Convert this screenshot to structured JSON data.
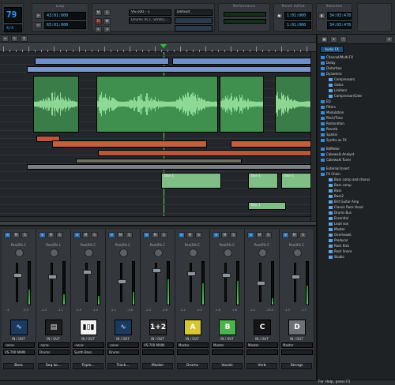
{
  "control_bar": {
    "tempo_display": "79",
    "meter_display": "4/4",
    "loop_module": {
      "label": "Loop",
      "start": "43:01:000",
      "end": "65:01:000"
    },
    "toolbar_buttons": [
      "M",
      "S",
      "R",
      "W"
    ],
    "track_select": "VS-100 - 1",
    "track_name": "Drums ACT, Strato...",
    "preset_select": "Default",
    "performance_label": "Performance",
    "punch_module": {
      "label": "Punch In/Out",
      "start": "1:01:000",
      "end": "1:01:000"
    },
    "selection_module": {
      "label": "Selection",
      "start": "34:03:478",
      "end": "34:03:478"
    }
  },
  "track_view": {
    "clip_labels": [
      "Take 1",
      "Take 1",
      "Take 1",
      "Take 1"
    ]
  },
  "console": {
    "strips": [
      {
        "pan_label": "Pan(0% C",
        "db_left": "-4",
        "db_right": "-3.3",
        "tile": "wave",
        "io": "IN / OUT",
        "input": "-none-",
        "output": "VS-700 MAIN",
        "name": "Bass"
      },
      {
        "pan_label": "Pan(0% L",
        "db_left": "-4.3",
        "db_right": "-1.1",
        "tile": "seq",
        "io": "IN / OUT",
        "input": "-none-",
        "output": "Drums",
        "name": "Seq ko..."
      },
      {
        "pan_label": "Pan(0% C",
        "db_left": "-1.5",
        "db_right": "-1.4",
        "tile": "keys",
        "io": "IN / OUT",
        "input": "-none-",
        "output": "Synth Bass",
        "name": "Triple..."
      },
      {
        "pan_label": "Pan(0% C",
        "db_left": "-2.2",
        "db_right": "-3.8",
        "tile": "wave",
        "io": "IN / OUT",
        "input": "-none-",
        "output": "Drums",
        "name": "Track..."
      },
      {
        "pan_label": "Pan(0% C",
        "db_left": "-2.3",
        "db_right": "-4.8",
        "tile": "1+2",
        "io": "IN / OUT",
        "input": "VS-700 MAIN",
        "output": "",
        "name": "Master"
      },
      {
        "pan_label": "Pan(0% C",
        "db_left": "-2.2",
        "db_right": "-0.2",
        "tile": "A",
        "io": "IN / OUT",
        "input": "Master",
        "output": "",
        "name": "Drums"
      },
      {
        "pan_label": "Pan(0% C",
        "db_left": "-1.8",
        "db_right": "-1.8",
        "tile": "B",
        "io": "IN / OUT",
        "input": "Master",
        "output": "",
        "name": "Vocals"
      },
      {
        "pan_label": "Pan(0% C",
        "db_left": "-1.2",
        "db_right": "-20.2",
        "tile": "C",
        "io": "IN / OUT",
        "input": "Master",
        "output": "",
        "name": "Verb"
      },
      {
        "pan_label": "Pan(0% C",
        "db_left": "-1.3",
        "db_right": "-1.7",
        "tile": "D",
        "io": "IN / OUT",
        "input": "Master",
        "output": "",
        "name": "Strings"
      }
    ]
  },
  "browser": {
    "header": "Audio FX",
    "tree": [
      {
        "label": "Channel/Multi-FX",
        "level": 0
      },
      {
        "label": "Delay",
        "level": 0
      },
      {
        "label": "Distortion",
        "level": 0
      },
      {
        "label": "Dynamics",
        "level": 0
      },
      {
        "label": "Compressors",
        "level": 1
      },
      {
        "label": "Gates",
        "level": 1
      },
      {
        "label": "Limiters",
        "level": 1
      },
      {
        "label": "Compressor/Gate",
        "level": 1
      },
      {
        "label": "EQ",
        "level": 0
      },
      {
        "label": "Filters",
        "level": 0
      },
      {
        "label": "Modulation",
        "level": 0
      },
      {
        "label": "Pitch/Time",
        "level": 0
      },
      {
        "label": "Restoration",
        "level": 0
      },
      {
        "label": "Reverb",
        "level": 0
      },
      {
        "label": "Spatial",
        "level": 0
      },
      {
        "label": "Synths as FX",
        "level": 0
      },
      {
        "label": "",
        "level": -1
      },
      {
        "label": "BitMeter",
        "level": 0
      },
      {
        "label": "Cakewalk Analyst",
        "level": 0
      },
      {
        "label": "Cakewalk Tuner",
        "level": 0
      },
      {
        "label": "",
        "level": -1
      },
      {
        "label": "External Insert",
        "level": 0
      },
      {
        "label": "FX Chain",
        "level": 0
      },
      {
        "label": "Bass comp and chorus",
        "level": 1
      },
      {
        "label": "Bass comp",
        "level": 1
      },
      {
        "label": "Bass",
        "level": 1
      },
      {
        "label": "Bass2",
        "level": 1
      },
      {
        "label": "Brit Guitar Amp",
        "level": 1
      },
      {
        "label": "Classic Rock Vocal",
        "level": 1
      },
      {
        "label": "Drums Bus",
        "level": 1
      },
      {
        "label": "Essential",
        "level": 1
      },
      {
        "label": "Lead vox",
        "level": 1
      },
      {
        "label": "Master",
        "level": 1
      },
      {
        "label": "Overheads",
        "level": 1
      },
      {
        "label": "Producer",
        "level": 1
      },
      {
        "label": "Rock Kick",
        "level": 1
      },
      {
        "label": "Rock Snare",
        "level": 1
      },
      {
        "label": "Studio",
        "level": 1
      }
    ]
  },
  "status_bar": {
    "text": "For Help, press F1"
  },
  "colors": {
    "accent_blue": "#2d9cff",
    "clip_green": "#3f8f4f",
    "clip_blue": "#6f8fc9",
    "clip_orange": "#b8573e"
  }
}
